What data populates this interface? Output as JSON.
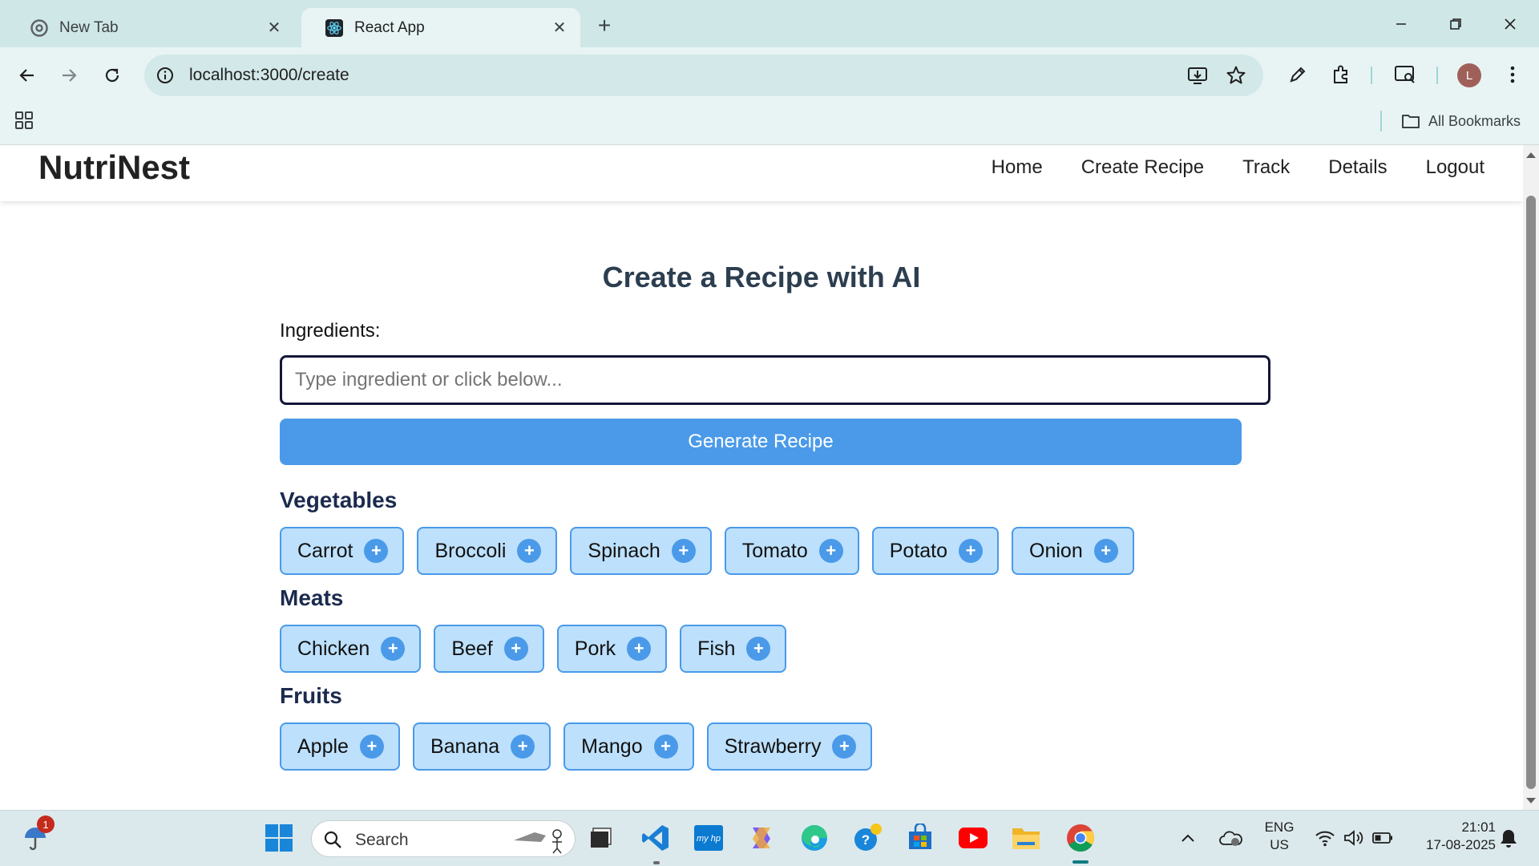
{
  "browser": {
    "tabs": [
      {
        "title": "New Tab",
        "active": false
      },
      {
        "title": "React App",
        "active": true
      }
    ],
    "url": "localhost:3000/create",
    "bookmarks_label": "All Bookmarks",
    "profile_initial": "L"
  },
  "app": {
    "brand": "NutriNest",
    "nav": [
      "Home",
      "Create Recipe",
      "Track",
      "Details",
      "Logout"
    ],
    "title": "Create a Recipe with AI",
    "ingredients_label": "Ingredients:",
    "ingredients_value": "",
    "ingredients_placeholder": "Type ingredient or click below...",
    "generate_label": "Generate Recipe",
    "add_symbol": "+",
    "categories": [
      {
        "name": "Vegetables",
        "items": [
          "Carrot",
          "Broccoli",
          "Spinach",
          "Tomato",
          "Potato",
          "Onion"
        ]
      },
      {
        "name": "Meats",
        "items": [
          "Chicken",
          "Beef",
          "Pork",
          "Fish"
        ]
      },
      {
        "name": "Fruits",
        "items": [
          "Apple",
          "Banana",
          "Mango",
          "Strawberry"
        ]
      }
    ]
  },
  "taskbar": {
    "search_label": "Search",
    "notification_count": "1",
    "language": "ENG",
    "region": "US",
    "time": "21:01",
    "date": "17-08-2025"
  },
  "colors": {
    "accent": "#4a9ae9",
    "chip_bg": "#bde0fc",
    "heading": "#1b2a4e",
    "chrome_tabbar": "#cfe7e7"
  }
}
